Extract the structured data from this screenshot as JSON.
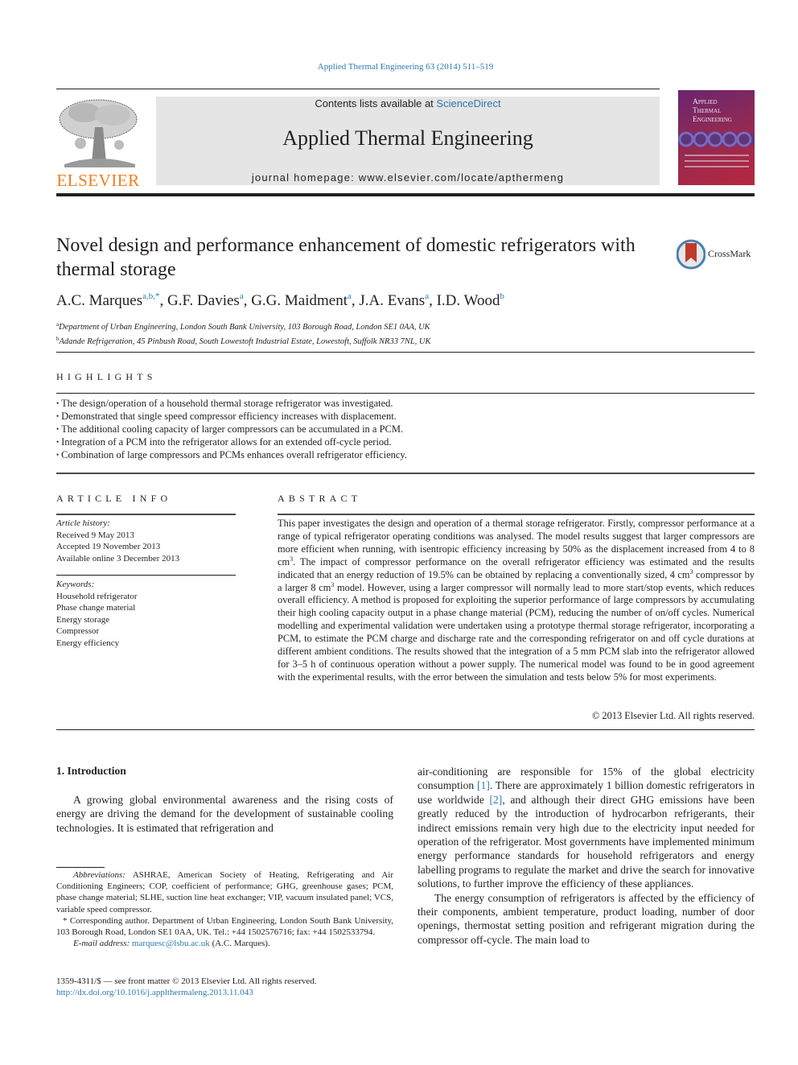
{
  "running_head": "Applied Thermal Engineering 63 (2014) 511–519",
  "masthead": {
    "publisher_logo_text": "ELSEVIER",
    "contents_prefix": "Contents lists available at ",
    "contents_link": "ScienceDirect",
    "journal_name": "Applied Thermal Engineering",
    "homepage": "journal homepage: www.elsevier.com/locate/apthermeng",
    "cover_title_lines": [
      "Applied",
      "Thermal",
      "Engineering"
    ],
    "colors": {
      "elsevier_orange": "#f07d1a",
      "link_blue": "#2a7ab0",
      "masthead_gray": "#e5e5e5"
    }
  },
  "article": {
    "title": "Novel design and performance enhancement of domestic refrigerators with thermal storage",
    "crossmark_label": "CrossMark",
    "authors": [
      {
        "name": "A.C. Marques",
        "sup": "a,b,",
        "star": "*"
      },
      {
        "name": "G.F. Davies",
        "sup": "a"
      },
      {
        "name": "G.G. Maidment",
        "sup": "a"
      },
      {
        "name": "J.A. Evans",
        "sup": "a"
      },
      {
        "name": "I.D. Wood",
        "sup": "b"
      }
    ],
    "affiliations": [
      {
        "mark": "a",
        "text": "Department of Urban Engineering, London South Bank University, 103 Borough Road, London SE1 0AA, UK"
      },
      {
        "mark": "b",
        "text": "Adande Refrigeration, 45 Pinbush Road, South Lowestoft Industrial Estate, Lowestoft, Suffolk NR33 7NL, UK"
      }
    ]
  },
  "highlights": {
    "heading": "HIGHLIGHTS",
    "items": [
      "The design/operation of a household thermal storage refrigerator was investigated.",
      "Demonstrated that single speed compressor efficiency increases with displacement.",
      "The additional cooling capacity of larger compressors can be accumulated in a PCM.",
      "Integration of a PCM into the refrigerator allows for an extended off-cycle period.",
      "Combination of large compressors and PCMs enhances overall refrigerator efficiency."
    ]
  },
  "article_info": {
    "heading": "ARTICLE INFO",
    "history_label": "Article history:",
    "history": [
      "Received 9 May 2013",
      "Accepted 19 November 2013",
      "Available online 3 December 2013"
    ],
    "keywords_label": "Keywords:",
    "keywords": [
      "Household refrigerator",
      "Phase change material",
      "Energy storage",
      "Compressor",
      "Energy efficiency"
    ]
  },
  "abstract": {
    "heading": "ABSTRACT",
    "seg1": "This paper investigates the design and operation of a thermal storage refrigerator. Firstly, compressor performance at a range of typical refrigerator operating conditions was analysed. The model results suggest that larger compressors are more efficient when running, with isentropic efficiency increasing by 50% as the displacement increased from 4 to 8 cm",
    "seg2": ". The impact of compressor performance on the overall refrigerator efficiency was estimated and the results indicated that an energy reduction of 19.5% can be obtained by replacing a conventionally sized, 4 cm",
    "seg3": " compressor by a larger 8 cm",
    "seg4": " model. However, using a larger compressor will normally lead to more start/stop events, which reduces overall efficiency. A method is proposed for exploiting the superior performance of large compressors by accumulating their high cooling capacity output in a phase change material (PCM), reducing the number of on/off cycles. Numerical modelling and experimental validation were undertaken using a prototype thermal storage refrigerator, incorporating a PCM, to estimate the PCM charge and discharge rate and the corresponding refrigerator on and off cycle durations at different ambient conditions. The results showed that the integration of a 5 mm PCM slab into the refrigerator allowed for 3–5 h of continuous operation without a power supply. The numerical model was found to be in good agreement with the experimental results, with the error between the simulation and tests below 5% for most experiments.",
    "superscript": "3",
    "copyright": "© 2013 Elsevier Ltd. All rights reserved."
  },
  "body": {
    "intro_heading": "1.  Introduction",
    "intro_p1": "A growing global environmental awareness and the rising costs of energy are driving the demand for the development of sustain­able cooling technologies. It is estimated that refrigeration and",
    "right_p1_a": "air-conditioning are responsible for 15% of the global electricity consumption ",
    "ref1": "[1]",
    "right_p1_b": ". There are approximately 1 billion domestic re­frigerators in use worldwide ",
    "ref2": "[2]",
    "right_p1_c": ", and although their direct GHG emissions have been greatly reduced by the introduction of hy­drocarbon refrigerants, their indirect emissions remain very high due to the electricity input needed for operation of the refrigerator. Most governments have implemented minimum energy perfor­mance standards for household refrigerators and energy labelling programs to regulate the market and drive the search for innovative solutions, to further improve the efficiency of these appliances.",
    "right_p2": "The energy consumption of refrigerators is affected by the effi­ciency of their components, ambient temperature, product loading, number of door openings, thermostat setting position and refrig­erant migration during the compressor off-cycle. The main load to"
  },
  "footnotes": {
    "abbrev_label": "Abbreviations:",
    "abbrev_text": " ASHRAE, American Society of Heating, Refrigerating and Air Conditioning Engineers; COP, coefficient of performance; GHG, greenhouse gases; PCM, phase change material; SLHE, suction line heat exchanger; VIP, vacuum insulated panel; VCS, variable speed compressor.",
    "corresponding": "* Corresponding author. Department of Urban Engineering, London South Bank University, 103 Borough Road, London SE1 0AA, UK. Tel.: +44 1502576716; fax: +44 1502533794.",
    "email_label": "E-mail address:",
    "email": "marquesc@lsbu.ac.uk",
    "email_owner": " (A.C. Marques)."
  },
  "front_matter": {
    "issn_line": "1359-4311/$ — see front matter © 2013 Elsevier Ltd. All rights reserved.",
    "doi": "http://dx.doi.org/10.1016/j.applthermaleng.2013.11.043"
  }
}
